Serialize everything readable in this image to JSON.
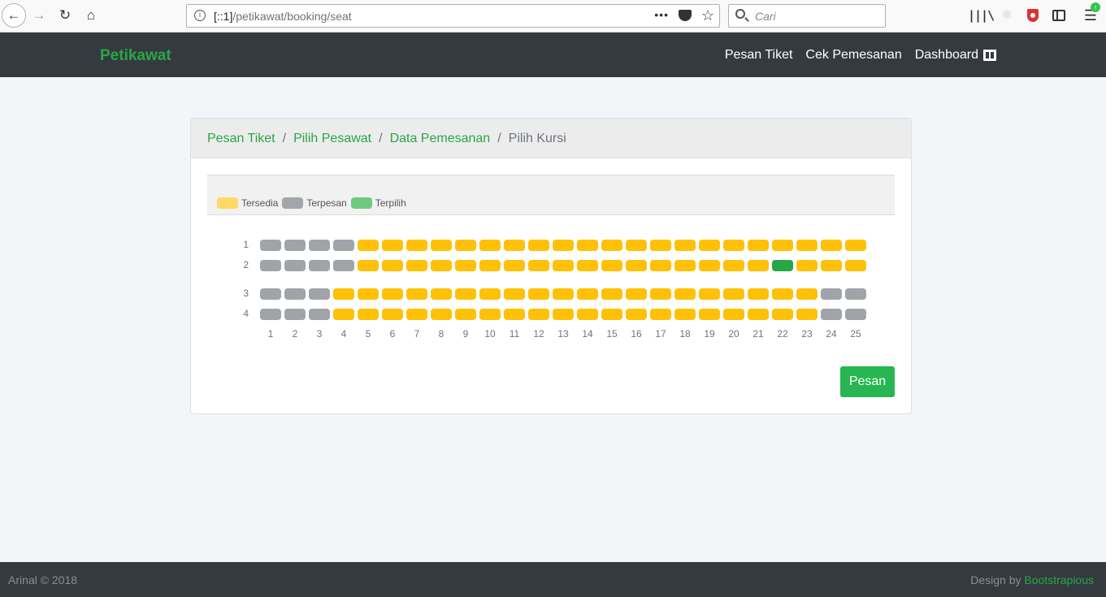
{
  "browser": {
    "url_host": "[::1]",
    "url_path": "/petikawat/booking/seat",
    "url_dots": "•••",
    "search_placeholder": "Cari"
  },
  "navbar": {
    "brand": "Petikawat",
    "links": [
      {
        "label": "Pesan Tiket"
      },
      {
        "label": "Cek Pemesanan"
      },
      {
        "label": "Dashboard"
      }
    ]
  },
  "breadcrumb": {
    "items": [
      "Pesan Tiket",
      "Pilih Pesawat",
      "Data Pemesanan"
    ],
    "separator": "/",
    "active": "Pilih Kursi"
  },
  "legend": [
    {
      "label": "Tersedia",
      "color": "#ffd966"
    },
    {
      "label": "Terpesan",
      "color": "#a3a7ab"
    },
    {
      "label": "Terpilih",
      "color": "#6fc97f"
    }
  ],
  "seat_colors": {
    "available": "#ffc107",
    "booked": "#a0a4a8",
    "selected": "#28a745"
  },
  "seats": {
    "row_labels": [
      "1",
      "2",
      "3",
      "4"
    ],
    "column_labels": [
      "1",
      "2",
      "3",
      "4",
      "5",
      "6",
      "7",
      "8",
      "9",
      "10",
      "11",
      "12",
      "13",
      "14",
      "15",
      "16",
      "17",
      "18",
      "19",
      "20",
      "21",
      "22",
      "23",
      "24",
      "25"
    ],
    "status_rows": [
      "BBBBAAAAAAAAAAAAAAAAAAAAA",
      "BBBBAAAAAAAAAAAAAAAAASAAA",
      "BBBAAAAAAAAAAAAAAAAAAAABB",
      "BBBAAAAAAAAAAAAAAAAAAAABB"
    ],
    "status_legend": {
      "B": "booked",
      "A": "available",
      "S": "selected"
    }
  },
  "submit_label": "Pesan",
  "footer": {
    "copyright": "Arinal © 2018",
    "design_prefix": "Design by ",
    "design_link": "Bootstrapious"
  }
}
